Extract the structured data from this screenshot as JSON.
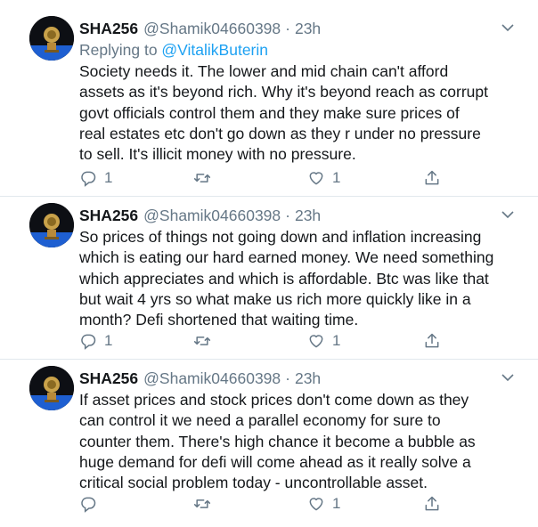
{
  "tweets": [
    {
      "name": "SHA256",
      "handle": "@Shamik04660398",
      "separator": "·",
      "time": "23h",
      "reply_prefix": "Replying to ",
      "reply_to": "@VitalikButerin",
      "lines": [
        "Society needs it. The lower and mid chain can't afford",
        "assets as it's beyond rich. Why it's beyond reach as corrupt",
        "govt officials control them and they make sure prices of",
        "real estates etc don't go down as they r under no pressure",
        "to sell. It's illicit money with no pressure."
      ],
      "reply_count": "1",
      "retweet_count": "",
      "like_count": "1"
    },
    {
      "name": "SHA256",
      "handle": "@Shamik04660398",
      "separator": "·",
      "time": "23h",
      "lines": [
        "So prices of things not going down and inflation increasing",
        "which is eating our hard earned money. We need something",
        "which appreciates and which is affordable. Btc was like that",
        "but wait 4 yrs so what make us rich more quickly like in a",
        "month? Defi shortened that waiting time."
      ],
      "reply_count": "1",
      "retweet_count": "",
      "like_count": "1"
    },
    {
      "name": "SHA256",
      "handle": "@Shamik04660398",
      "separator": "·",
      "time": "23h",
      "lines": [
        "If asset prices and stock prices don't come down as they",
        "can control it we need a parallel economy for sure to",
        "counter them. There's high chance it become a bubble as",
        "huge demand for defi will come ahead as it really solve a",
        "critical  social problem today - uncontrollable asset."
      ],
      "reply_count": "",
      "retweet_count": "",
      "like_count": "1"
    }
  ],
  "icons": {
    "avatar": "avatar-icon",
    "menu": "chevron-down-icon",
    "reply": "reply-icon",
    "retweet": "retweet-icon",
    "like": "heart-icon",
    "share": "share-icon"
  },
  "colors": {
    "text": "#14171a",
    "secondary": "#657786",
    "link": "#1da1f2",
    "divider": "#e1e8ed"
  }
}
